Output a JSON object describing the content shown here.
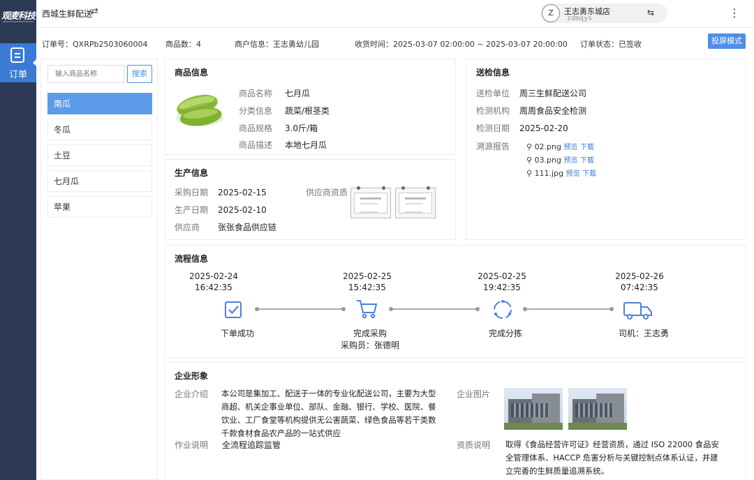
{
  "brand": {
    "logo_text": "观麦科技"
  },
  "nav": {
    "order_label": "订单"
  },
  "topbar": {
    "store_name": "西城生鲜配送",
    "swap_icon": "⇄",
    "user_initial": "Z",
    "user_name": "王志勇东城店",
    "user_id": "zdmqys",
    "user_swap_icon": "⇆",
    "more_icon": "⋮"
  },
  "summary": {
    "order_no": "订单号：QXRPb2503060004",
    "item_count": "商品数：4",
    "merchant": "商户信息：王志勇幼儿园",
    "receive_time": "收货时间：2025-03-07 02:00:00 ~ 2025-03-07 20:00:00",
    "status": "订单状态：已签收",
    "projection_button": "投屏模式"
  },
  "product_list": {
    "search_placeholder": "输入商品名称",
    "search_button": "搜索",
    "items": [
      "南瓜",
      "冬瓜",
      "土豆",
      "七月瓜",
      "苹果"
    ],
    "active_index": 0
  },
  "product_info": {
    "title": "商品信息",
    "name_label": "商品名称",
    "name_value": "七月瓜",
    "category_label": "分类信息",
    "category_value": "蔬菜/根茎类",
    "spec_label": "商品规格",
    "spec_value": "3.0斤/箱",
    "desc_label": "商品描述",
    "desc_value": "本地七月瓜"
  },
  "inspection": {
    "title": "送检信息",
    "unit_label": "送检单位",
    "unit_value": "周三生鲜配送公司",
    "agency_label": "检测机构",
    "agency_value": "周周食品安全检测",
    "date_label": "检测日期",
    "date_value": "2025-02-20",
    "report_label": "溯源报告",
    "files": [
      {
        "name": "02.png",
        "preview": "预览",
        "download": "下载"
      },
      {
        "name": "03.png",
        "preview": "预览",
        "download": "下载"
      },
      {
        "name": "111.jpg",
        "preview": "预览",
        "download": "下载"
      }
    ]
  },
  "production": {
    "title": "生产信息",
    "purchase_date_label": "采购日期",
    "purchase_date_value": "2025-02-15",
    "production_date_label": "生产日期",
    "production_date_value": "2025-02-10",
    "supplier_label": "供应商",
    "supplier_value": "张张食品供应链",
    "qualification_label": "供应商资质"
  },
  "process": {
    "title": "流程信息",
    "steps": [
      {
        "date": "2025-02-24",
        "time": "16:42:35",
        "label": "下单成功",
        "sub": ""
      },
      {
        "date": "2025-02-25",
        "time": "15:42:35",
        "label": "完成采购",
        "sub": "采购员：张德明"
      },
      {
        "date": "2025-02-25",
        "time": "19:42:35",
        "label": "完成分拣",
        "sub": ""
      },
      {
        "date": "2025-02-26",
        "time": "07:42:35",
        "label": "司机：王志勇",
        "sub": ""
      }
    ],
    "icon_color": "#4d7fe0"
  },
  "enterprise": {
    "title": "企业形象",
    "intro_label": "企业介绍",
    "intro_lines": [
      "本公司是集加工、配送于一体的专业化配送公司，主要为大型",
      "商超、机关企事业单位、部队、金融、银行、学校、医院、餐",
      "饮业、工厂食堂等机构提供无公害蔬菜、绿色食品等若干类数",
      "千款食材食品农产品的一站式供应"
    ],
    "photos_label": "企业图片",
    "operation_label": "作业说明",
    "operation_value": "全流程追踪监管",
    "qual_label": "资质说明",
    "qual_lines": [
      "取得《食品经营许可证》经营资质，通过 ISO 22000 食品安",
      "全管理体系、HACCP 危害分析与关键控制点体系认证，并建",
      "立完善的生鲜质量追溯系统。"
    ]
  }
}
